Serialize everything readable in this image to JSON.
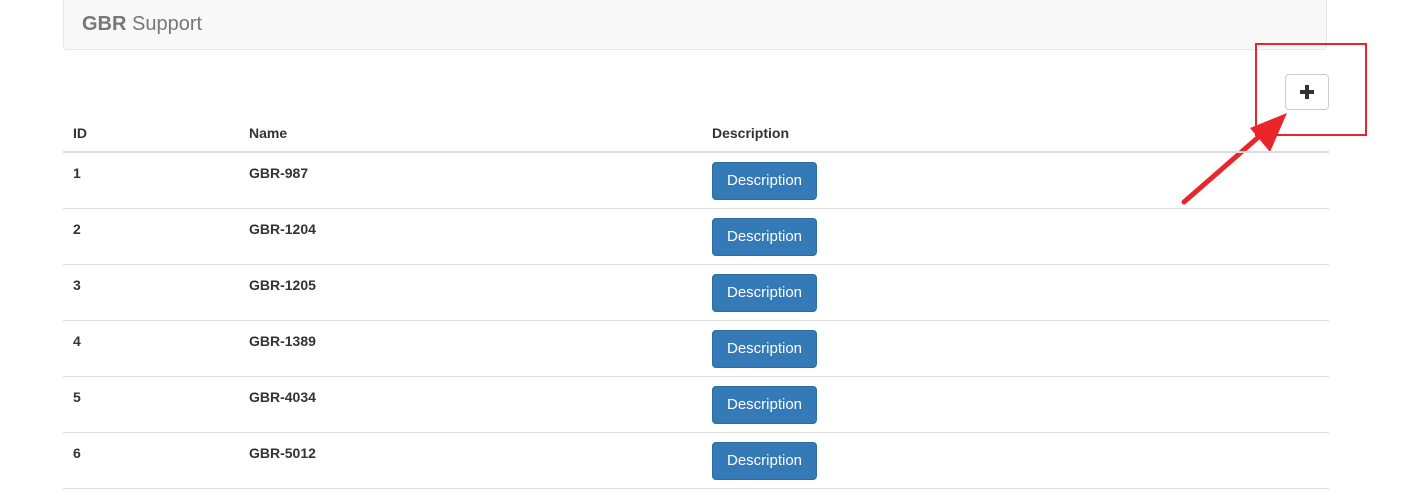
{
  "navbar": {
    "brand_bold": "GBR",
    "brand_rest": "Support"
  },
  "add_button": {
    "icon": "plus-icon"
  },
  "annotation": {
    "color": "#e8262b"
  },
  "table": {
    "headers": {
      "id": "ID",
      "name": "Name",
      "description": "Description"
    },
    "rows": [
      {
        "id": "1",
        "name": "GBR-987",
        "button": "Description"
      },
      {
        "id": "2",
        "name": "GBR-1204",
        "button": "Description"
      },
      {
        "id": "3",
        "name": "GBR-1205",
        "button": "Description"
      },
      {
        "id": "4",
        "name": "GBR-1389",
        "button": "Description"
      },
      {
        "id": "5",
        "name": "GBR-4034",
        "button": "Description"
      },
      {
        "id": "6",
        "name": "GBR-5012",
        "button": "Description"
      }
    ]
  },
  "colors": {
    "primary": "#337ab7",
    "navbar_bg": "#f8f8f8",
    "border": "#dddddd"
  }
}
